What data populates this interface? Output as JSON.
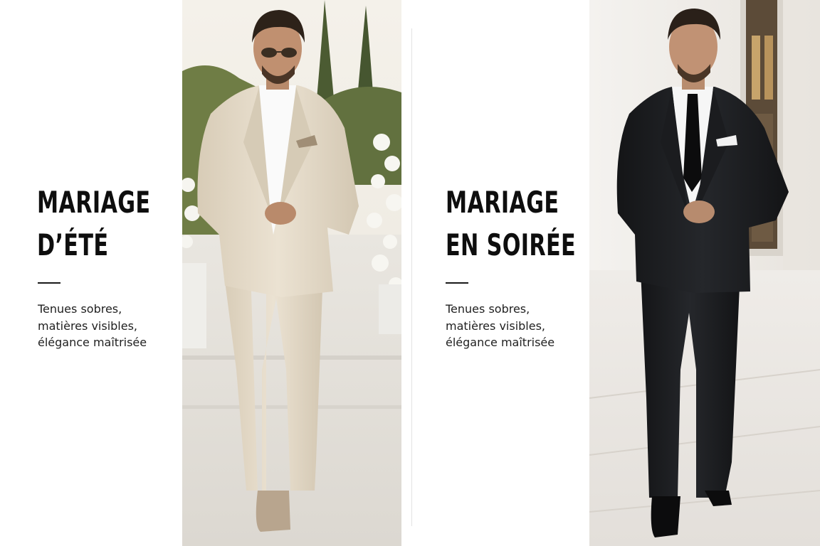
{
  "panels": [
    {
      "title_lines": [
        "MARIAGE",
        "D’ÉTÉ"
      ],
      "subtitle": "Tenues sobres,\nmatières visibles,\nélégance maîtrisée"
    },
    {
      "title_lines": [
        "MARIAGE",
        "EN SOIRÉE"
      ],
      "subtitle": "Tenues sobres,\nmatières visibles,\nélégance maîtrisée"
    }
  ],
  "photos": [
    {
      "icon": "summer-wedding-outfit-photo",
      "suit_color": "#e6dccb",
      "background": "#f2efe9"
    },
    {
      "icon": "evening-wedding-outfit-photo",
      "suit_color": "#1d1f22",
      "background": "#f3f1ee"
    }
  ]
}
